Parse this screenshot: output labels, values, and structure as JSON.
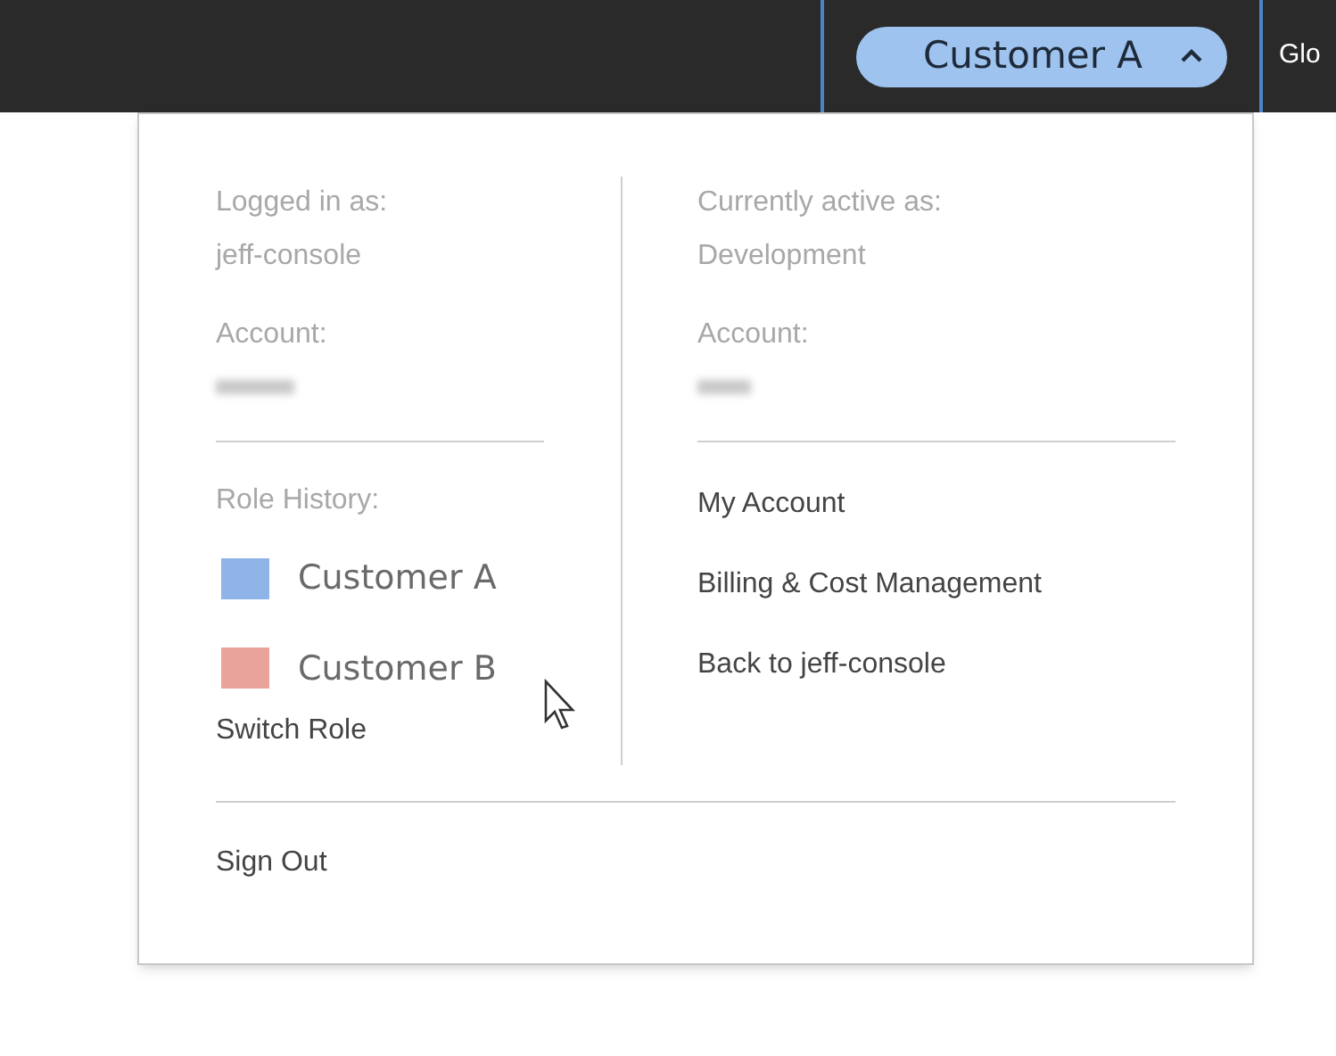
{
  "top_bar": {
    "role_button": {
      "label": "Customer A",
      "expanded": true
    },
    "next_item": "Glo"
  },
  "menu": {
    "left": {
      "logged_in_label": "Logged in as:",
      "user": "jeff-console",
      "account_label": "Account:",
      "role_history_label": "Role History:",
      "roles": [
        {
          "name": "Customer A",
          "color": "#8fb4e8"
        },
        {
          "name": "Customer B",
          "color": "#eaa39a"
        }
      ],
      "switch_role": "Switch Role"
    },
    "right": {
      "active_label": "Currently active as:",
      "active_name": "Development",
      "account_label": "Account:",
      "links": [
        "My Account",
        "Billing & Cost Management",
        "Back to jeff-console"
      ]
    },
    "sign_out": "Sign Out"
  }
}
